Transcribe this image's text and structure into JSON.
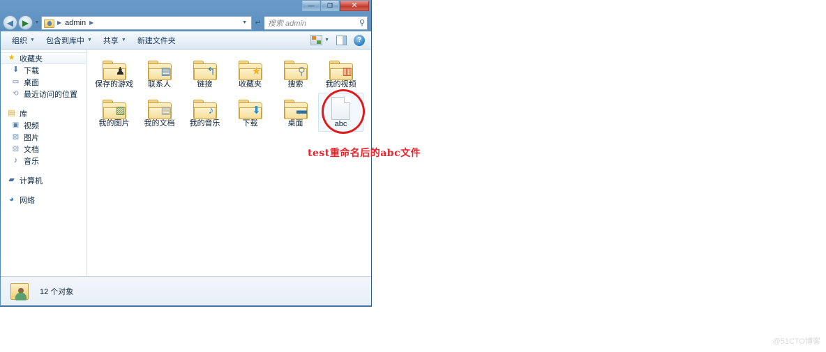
{
  "window": {
    "title": "",
    "controls": {
      "minimize": "—",
      "maximize": "❐",
      "close": "✕"
    }
  },
  "address": {
    "back_icon": "◀",
    "forward_icon": "▶",
    "history_caret": "▼",
    "folder_icon": "user-folder-icon",
    "crumbs": [
      "admin"
    ],
    "crumb_separator": "▶",
    "dropdown_caret": "▼",
    "refresh_icon": "↵",
    "search_placeholder": "搜索 admin",
    "search_icon": "⚲"
  },
  "toolbar": {
    "organize_label": "组织",
    "include_in_library_label": "包含到库中",
    "share_label": "共享",
    "new_folder_label": "新建文件夹",
    "caret": "▼",
    "views_icon": "views-icon",
    "preview_pane_icon": "preview-pane-icon",
    "help_icon": "?"
  },
  "sidebar": {
    "groups": [
      {
        "root": {
          "label": "收藏夹",
          "icon": "star-icon",
          "icon_class": "ico-star",
          "glyph": "★",
          "highlighted": true
        },
        "items": [
          {
            "label": "下载",
            "icon": "download-icon",
            "icon_class": "ico-dl",
            "glyph": "⬇"
          },
          {
            "label": "桌面",
            "icon": "desktop-icon",
            "icon_class": "ico-desk",
            "glyph": "▭"
          },
          {
            "label": "最近访问的位置",
            "icon": "recent-places-icon",
            "icon_class": "ico-recent",
            "glyph": "⟲"
          }
        ]
      },
      {
        "root": {
          "label": "库",
          "icon": "library-icon",
          "icon_class": "ico-lib",
          "glyph": "▤",
          "highlighted": false
        },
        "items": [
          {
            "label": "视频",
            "icon": "video-icon",
            "icon_class": "ico-vid",
            "glyph": "▣"
          },
          {
            "label": "图片",
            "icon": "pictures-icon",
            "icon_class": "ico-pic",
            "glyph": "▨"
          },
          {
            "label": "文档",
            "icon": "documents-icon",
            "icon_class": "ico-doc",
            "glyph": "▧"
          },
          {
            "label": "音乐",
            "icon": "music-icon",
            "icon_class": "ico-mus",
            "glyph": "♪"
          }
        ]
      },
      {
        "root": {
          "label": "计算机",
          "icon": "computer-icon",
          "icon_class": "ico-pc",
          "glyph": "▰",
          "highlighted": false
        },
        "items": []
      },
      {
        "root": {
          "label": "网络",
          "icon": "network-icon",
          "icon_class": "ico-net",
          "glyph": "◕",
          "highlighted": false
        },
        "items": []
      }
    ]
  },
  "files": [
    {
      "label": "保存的游戏",
      "type": "folder",
      "emblem": "♟",
      "emblem_color": "#2b2b2b",
      "selected": false
    },
    {
      "label": "联系人",
      "type": "folder",
      "emblem": "▤",
      "emblem_color": "#4a86c8",
      "selected": false
    },
    {
      "label": "链接",
      "type": "folder",
      "emblem": "↰",
      "emblem_color": "#2b7fc4",
      "selected": false
    },
    {
      "label": "收藏夹",
      "type": "folder",
      "emblem": "★",
      "emblem_color": "#f0b323",
      "selected": false
    },
    {
      "label": "搜索",
      "type": "folder",
      "emblem": "⚲",
      "emblem_color": "#7d93a8",
      "selected": false
    },
    {
      "label": "我的视频",
      "type": "folder",
      "emblem": "▥",
      "emblem_color": "#c2562f",
      "selected": false
    },
    {
      "label": "我的图片",
      "type": "folder",
      "emblem": "▨",
      "emblem_color": "#4f8f54",
      "selected": false
    },
    {
      "label": "我的文档",
      "type": "folder",
      "emblem": "▤",
      "emblem_color": "#9aa7b3",
      "selected": false
    },
    {
      "label": "我的音乐",
      "type": "folder",
      "emblem": "♪",
      "emblem_color": "#2b7fc4",
      "selected": false
    },
    {
      "label": "下载",
      "type": "folder",
      "emblem": "⬇",
      "emblem_color": "#2b8fd4",
      "selected": false
    },
    {
      "label": "桌面",
      "type": "folder",
      "emblem": "▬",
      "emblem_color": "#2f6fa8",
      "selected": false
    },
    {
      "label": "abc",
      "type": "document",
      "emblem": "",
      "emblem_color": "",
      "selected": true
    }
  ],
  "status": {
    "item_count_text": "12 个对象",
    "folder_icon": "user-folder-icon"
  },
  "annotation": {
    "ellipse_target": "abc",
    "text": "test重命名后的abc文件",
    "color": "#e8232a"
  },
  "watermark": {
    "text": "@51CTO博客"
  },
  "colors": {
    "title_bar": "#4d81b5",
    "close_button": "#bc3326",
    "annotation_red": "#e8232a",
    "selection_blue": "#f2f8fd",
    "folder_yellow": "#f0cf74"
  }
}
